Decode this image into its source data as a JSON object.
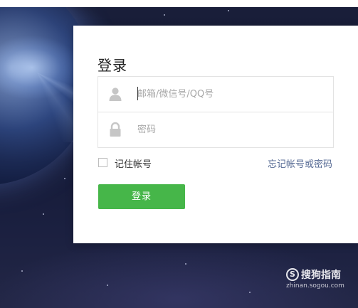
{
  "login": {
    "title": "登录",
    "account_placeholder": "邮箱/微信号/QQ号",
    "password_placeholder": "密码",
    "remember_label": "记住帐号",
    "forgot_link": "忘记帐号或密码",
    "submit_label": "登录"
  },
  "icons": {
    "account": "user-icon",
    "password": "lock-icon",
    "watermark": "sogou-logo-icon"
  },
  "colors": {
    "button": "#46b649",
    "link": "#576b95"
  },
  "watermark": {
    "name": "搜狗指南",
    "url": "zhinan.sogou.com",
    "logo_letter": "S"
  }
}
